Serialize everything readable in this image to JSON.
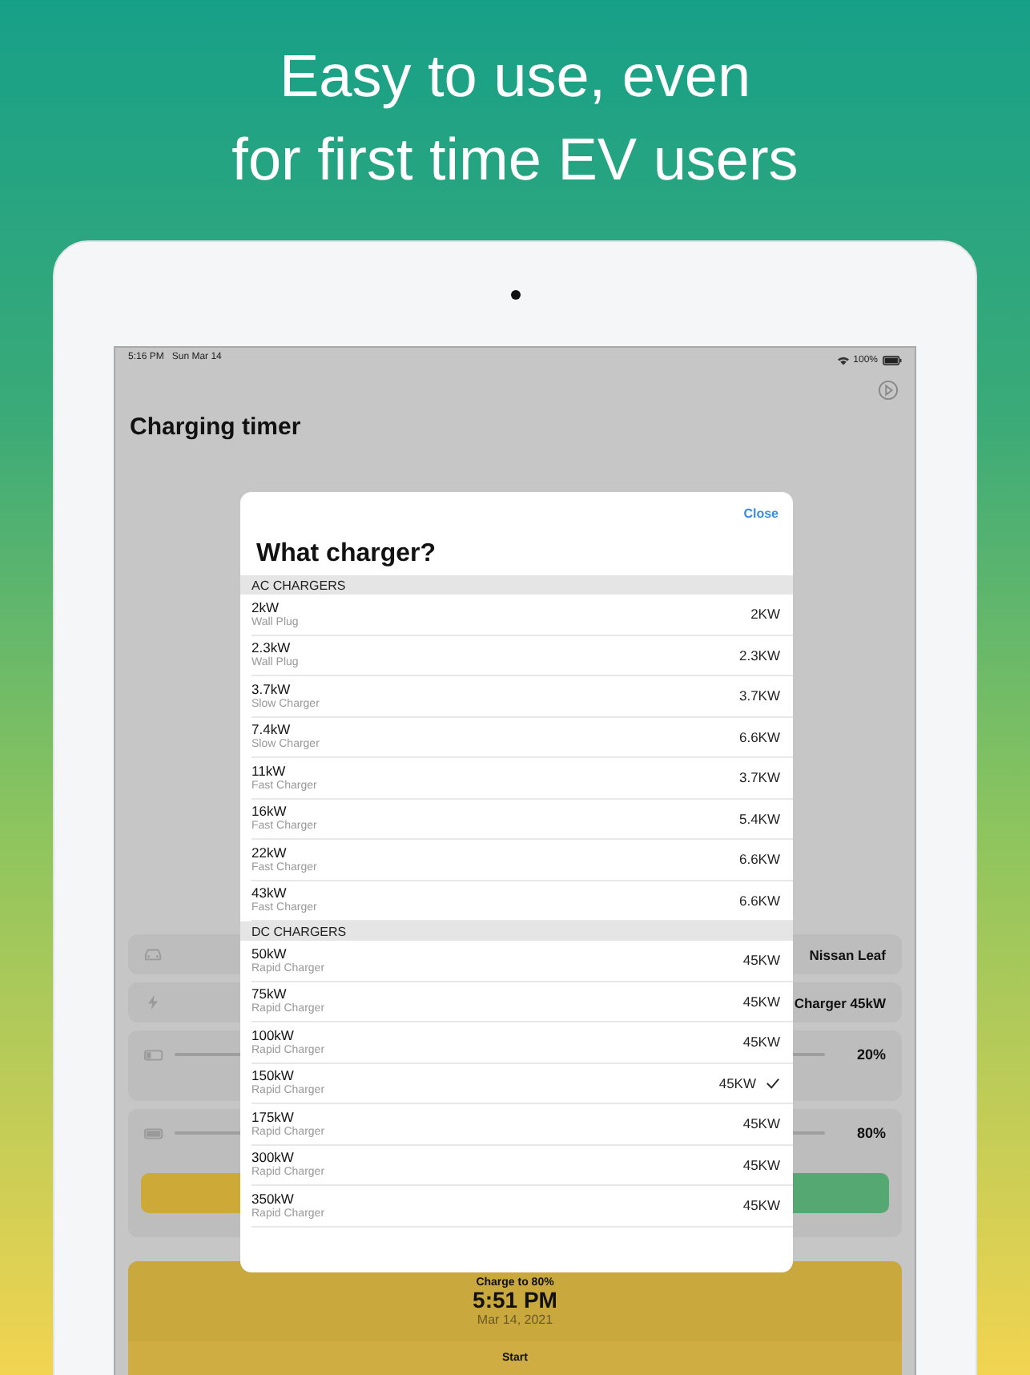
{
  "headline": [
    "Easy to use, even",
    "for first time EV users"
  ],
  "status_bar": {
    "time": "5:16 PM",
    "date": "Sun Mar 14",
    "battery": "100%"
  },
  "title": "Charging timer",
  "settings": [
    {
      "kind": "car",
      "value": "Nissan Leaf"
    },
    {
      "kind": "charger",
      "value": "Charger 45kW"
    }
  ],
  "sliders": [
    {
      "kind": "start",
      "reading": "20%"
    },
    {
      "kind": "target",
      "reading": "80%"
    }
  ],
  "result": {
    "caption": "Charge to 80%",
    "time": "5:51 PM",
    "date": "Mar 14, 2021",
    "button": "Start"
  },
  "modal": {
    "close": "Close",
    "title": "What charger?",
    "sections": [
      {
        "header": "AC CHARGERS",
        "items": [
          {
            "name": "2kW",
            "type": "Wall Plug",
            "rate": "2KW",
            "selected": false
          },
          {
            "name": "2.3kW",
            "type": "Wall Plug",
            "rate": "2.3KW",
            "selected": false
          },
          {
            "name": "3.7kW",
            "type": "Slow Charger",
            "rate": "3.7KW",
            "selected": false
          },
          {
            "name": "7.4kW",
            "type": "Slow Charger",
            "rate": "6.6KW",
            "selected": false
          },
          {
            "name": "11kW",
            "type": "Fast Charger",
            "rate": "3.7KW",
            "selected": false
          },
          {
            "name": "16kW",
            "type": "Fast Charger",
            "rate": "5.4KW",
            "selected": false
          },
          {
            "name": "22kW",
            "type": "Fast Charger",
            "rate": "6.6KW",
            "selected": false
          },
          {
            "name": "43kW",
            "type": "Fast Charger",
            "rate": "6.6KW",
            "selected": false
          }
        ]
      },
      {
        "header": "DC CHARGERS",
        "items": [
          {
            "name": "50kW",
            "type": "Rapid Charger",
            "rate": "45KW",
            "selected": false
          },
          {
            "name": "75kW",
            "type": "Rapid Charger",
            "rate": "45KW",
            "selected": false
          },
          {
            "name": "100kW",
            "type": "Rapid Charger",
            "rate": "45KW",
            "selected": false
          },
          {
            "name": "150kW",
            "type": "Rapid Charger",
            "rate": "45KW",
            "selected": true
          },
          {
            "name": "175kW",
            "type": "Rapid Charger",
            "rate": "45KW",
            "selected": false
          },
          {
            "name": "300kW",
            "type": "Rapid Charger",
            "rate": "45KW",
            "selected": false
          },
          {
            "name": "350kW",
            "type": "Rapid Charger",
            "rate": "45KW",
            "selected": false
          }
        ]
      }
    ]
  }
}
